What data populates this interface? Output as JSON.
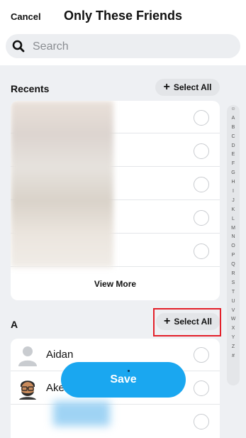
{
  "header": {
    "cancel_label": "Cancel",
    "title": "Only These Friends"
  },
  "search": {
    "placeholder": "Search",
    "value": ""
  },
  "recents": {
    "title": "Recents",
    "select_all_label": "Select All",
    "view_more_label": "View More"
  },
  "section_a": {
    "title": "A",
    "select_all_label": "Select All",
    "friends": [
      {
        "name": "Aidan"
      },
      {
        "name": "Ake"
      }
    ]
  },
  "index_letters": [
    "☺",
    "A",
    "B",
    "C",
    "D",
    "E",
    "F",
    "G",
    "H",
    "I",
    "J",
    "K",
    "L",
    "M",
    "N",
    "O",
    "P",
    "Q",
    "R",
    "S",
    "T",
    "U",
    "V",
    "W",
    "X",
    "Y",
    "Z",
    "#"
  ],
  "save_label": "Save",
  "colors": {
    "accent": "#1aa7f0",
    "highlight": "#e3202a"
  }
}
